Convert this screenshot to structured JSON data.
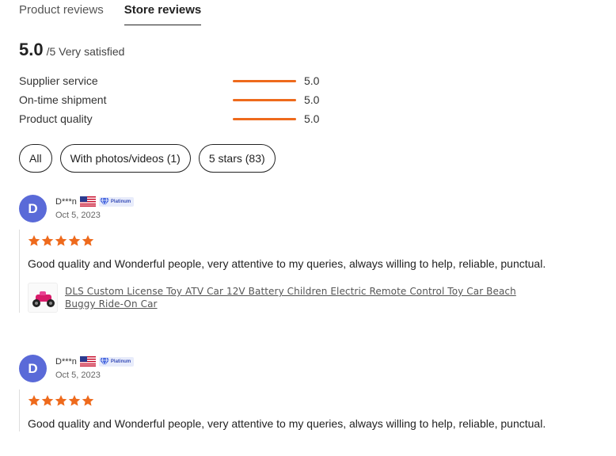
{
  "tabs": [
    {
      "label": "Product reviews",
      "active": false
    },
    {
      "label": "Store reviews",
      "active": true
    }
  ],
  "summary": {
    "score": "5.0",
    "suffix": "/5 Very satisfied"
  },
  "metrics": [
    {
      "label": "Supplier service",
      "value": "5.0",
      "fraction": 1.0
    },
    {
      "label": "On-time shipment",
      "value": "5.0",
      "fraction": 1.0
    },
    {
      "label": "Product quality",
      "value": "5.0",
      "fraction": 1.0
    }
  ],
  "filters": [
    {
      "label": "All"
    },
    {
      "label": "With photos/videos (1)"
    },
    {
      "label": "5 stars (83)"
    }
  ],
  "reviews": [
    {
      "avatar_letter": "D",
      "username": "D***n",
      "flag_icon": "us-flag-icon",
      "badge": "Platinum",
      "date": "Oct 5, 2023",
      "rating": 5,
      "text": "Good quality and Wonderful people, very attentive to my queries, always willing to help, reliable, punctual.",
      "product": "DLS Custom License Toy ATV Car 12V Battery Children Electric Remote Control Toy Car Beach Buggy Ride-On Car"
    },
    {
      "avatar_letter": "D",
      "username": "D***n",
      "flag_icon": "us-flag-icon",
      "badge": "Platinum",
      "date": "Oct 5, 2023",
      "rating": 5,
      "text": "Good quality and Wonderful people, very attentive to my queries, always willing to help, reliable, punctual."
    }
  ],
  "colors": {
    "accent": "#ee6a1c",
    "avatar": "#5a6ad8"
  }
}
